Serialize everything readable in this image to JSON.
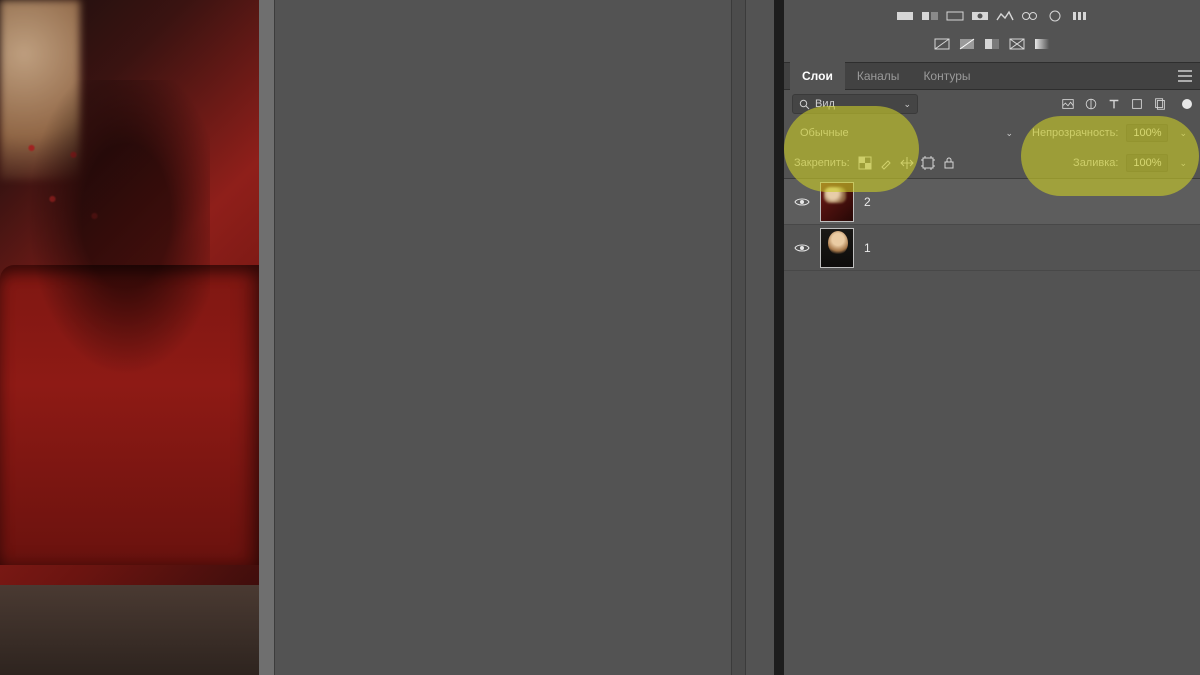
{
  "tabs": {
    "layers": "Слои",
    "channels": "Каналы",
    "paths": "Контуры"
  },
  "filter": {
    "label": "Вид"
  },
  "blend": {
    "mode": "Обычные",
    "opacity_label": "Непрозрачность:",
    "opacity_value": "100%"
  },
  "lock": {
    "label": "Закрепить:",
    "fill_label": "Заливка:",
    "fill_value": "100%"
  },
  "layers": [
    {
      "name": "2"
    },
    {
      "name": "1"
    }
  ]
}
